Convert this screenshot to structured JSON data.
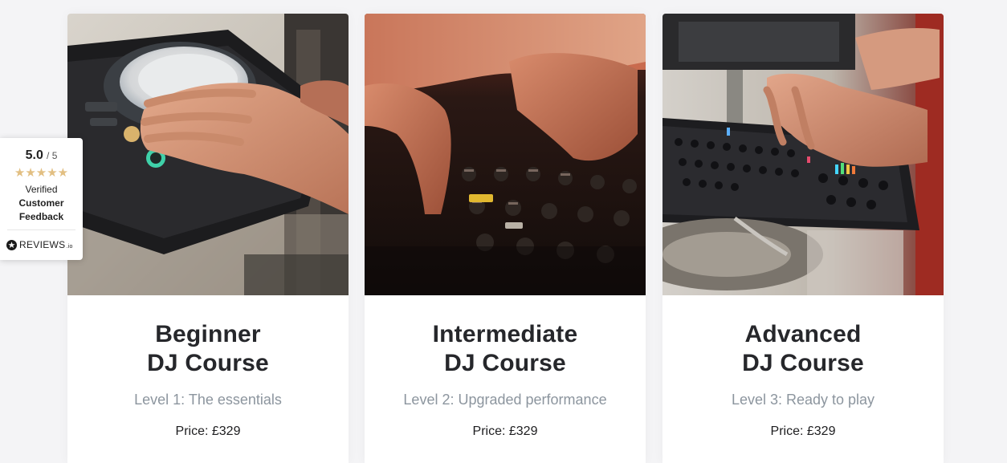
{
  "courses": [
    {
      "title_line1": "Beginner",
      "title_line2": "DJ Course",
      "level": "Level 1: The essentials",
      "price": "Price: £329",
      "image_icon": "dj-turntable-hand-photo"
    },
    {
      "title_line1": "Intermediate",
      "title_line2": "DJ Course",
      "level": "Level 2: Upgraded performance",
      "price": "Price: £329",
      "image_icon": "dj-mixer-knobs-photo"
    },
    {
      "title_line1": "Advanced",
      "title_line2": "DJ Course",
      "level": "Level 3: Ready to play",
      "price": "Price: £329",
      "image_icon": "dj-mixer-hands-photo"
    }
  ],
  "reviews_badge": {
    "score": "5.0",
    "out_of": "/ 5",
    "stars": "★★★★★",
    "rating_value": 5,
    "line1": "Verified",
    "line2": "Customer",
    "line3": "Feedback",
    "brand_name": "REVIEWS",
    "brand_suffix": ".io",
    "star_color": "#e2bf82"
  },
  "colors": {
    "page_background": "#f4f4f6",
    "card_background": "#ffffff",
    "title_text": "#26272b",
    "level_text": "#8c959e"
  }
}
